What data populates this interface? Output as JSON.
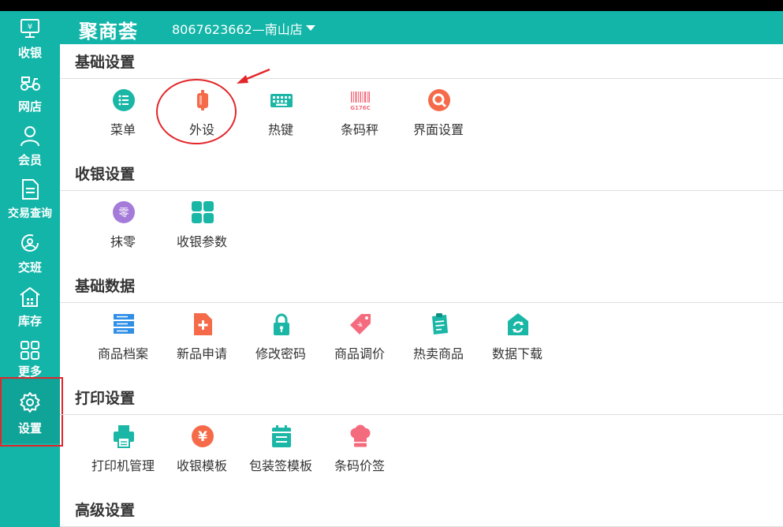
{
  "header": {
    "logo_text": "聚商荟",
    "store_name": "8067623662—南山店",
    "store_caret_icon": "caret-down-icon",
    "brand_color": "#12b5a8",
    "logo_accent_color": "#ffc22b"
  },
  "sidebar": {
    "items": [
      {
        "label": "收银",
        "icon": "cashier-icon"
      },
      {
        "label": "网店",
        "icon": "delivery-scooter-icon"
      },
      {
        "label": "会员",
        "icon": "member-icon"
      },
      {
        "label": "交易查询",
        "icon": "transaction-document-icon"
      },
      {
        "label": "交班",
        "icon": "shift-handover-icon"
      },
      {
        "label": "库存",
        "icon": "warehouse-icon"
      },
      {
        "label": "更多",
        "icon": "grid-more-icon"
      },
      {
        "label": "设置",
        "icon": "gear-icon",
        "active": true
      }
    ]
  },
  "sections": [
    {
      "title": "基础设置",
      "items": [
        {
          "label": "菜单",
          "icon": "menu-list-icon",
          "color": "#1bb7a6"
        },
        {
          "label": "外设",
          "icon": "peripheral-device-icon",
          "color": "#f56b4a"
        },
        {
          "label": "热键",
          "icon": "keyboard-icon",
          "color": "#1bb7a6"
        },
        {
          "label": "条码秤",
          "icon": "barcode-scale-icon",
          "color": "#f56b7e",
          "icon_text": "G176C"
        },
        {
          "label": "界面设置",
          "icon": "search-magnifier-icon",
          "color": "#f56b4a"
        }
      ]
    },
    {
      "title": "收银设置",
      "items": [
        {
          "label": "抹零",
          "icon": "round-off-icon",
          "color": "#a57bd9",
          "icon_text": "零"
        },
        {
          "label": "收银参数",
          "icon": "grid-params-icon",
          "color": "#1bb7a6"
        }
      ]
    },
    {
      "title": "基础数据",
      "items": [
        {
          "label": "商品档案",
          "icon": "server-stack-icon",
          "color": "#2f8fe6"
        },
        {
          "label": "新品申请",
          "icon": "new-product-document-icon",
          "color": "#f56b4a"
        },
        {
          "label": "修改密码",
          "icon": "lock-icon",
          "color": "#1bb7a6"
        },
        {
          "label": "商品调价",
          "icon": "price-tag-icon",
          "color": "#f56b7e"
        },
        {
          "label": "热卖商品",
          "icon": "hot-sale-clipboard-icon",
          "color": "#1bb7a6"
        },
        {
          "label": "数据下载",
          "icon": "data-download-house-icon",
          "color": "#1bb7a6"
        }
      ]
    },
    {
      "title": "打印设置",
      "items": [
        {
          "label": "打印机管理",
          "icon": "printer-icon",
          "color": "#1bb7a6"
        },
        {
          "label": "收银模板",
          "icon": "yen-coin-icon",
          "color": "#f56b4a"
        },
        {
          "label": "包装签模板",
          "icon": "calendar-label-icon",
          "color": "#1bb7a6"
        },
        {
          "label": "条码价签",
          "icon": "chef-hat-icon",
          "color": "#f56b7e"
        }
      ]
    },
    {
      "title": "高级设置",
      "items": []
    }
  ],
  "annotation_color": "#e3262a"
}
